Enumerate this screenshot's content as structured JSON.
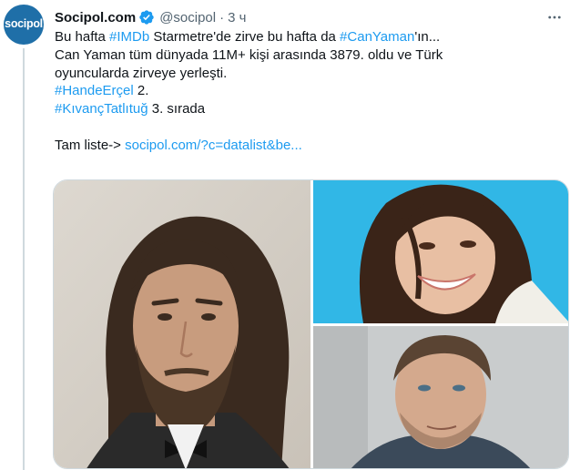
{
  "tweet": {
    "avatar_text": "socipol",
    "display_name": "Socipol.com",
    "handle": "@socipol",
    "separator": "·",
    "time": "3 ч",
    "icons": {
      "avatar": "socipol-logo",
      "verified": "verified-badge-icon",
      "more": "more-options-icon"
    },
    "colors": {
      "link": "#1d9bf0",
      "avatar_bg": "#1f6fa8",
      "verified": "#1d9bf0",
      "secondary_text": "#536471"
    },
    "text": {
      "l1_a": "Bu hafta ",
      "l1_link1": "#IMDb",
      "l1_b": " Starmetre'de zirve bu hafta da ",
      "l1_link2": "#CanYaman",
      "l1_c": "'ın...",
      "l2": "Can Yaman tüm dünyada 11M+ kişi arasında 3879. oldu ve Türk",
      "l3": "oyuncularda zirveye yerleşti.",
      "l4_link": "#HandeErçel",
      "l4_b": " 2.",
      "l5_link": "#KıvançTatlıtuğ",
      "l5_b": " 3. sırada",
      "l7_a": "Tam liste-> ",
      "l7_link": "socipol.com/?c=datalist&be..."
    },
    "media": {
      "photos": [
        "photo-long-haired-man",
        "photo-smiling-woman",
        "photo-man-in-cap"
      ]
    }
  }
}
